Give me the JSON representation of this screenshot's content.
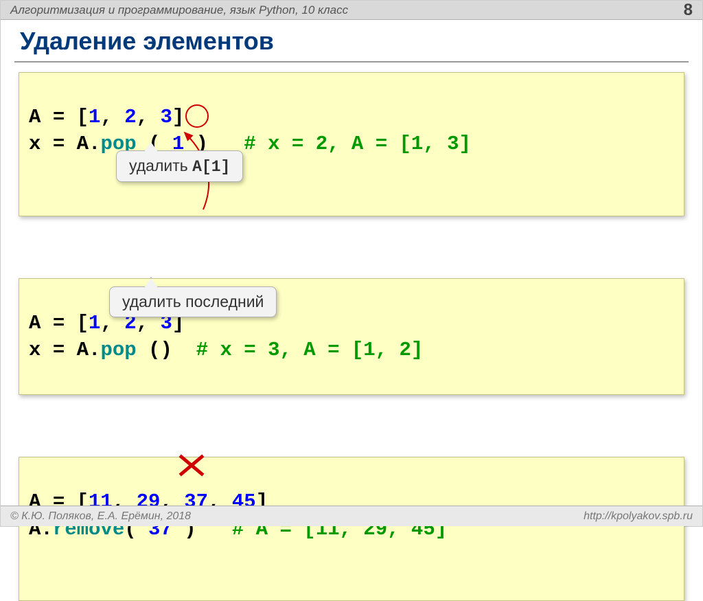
{
  "header": {
    "course": "Алгоритмизация и программирование, язык Python, 10 класс",
    "page_number": "8"
  },
  "title": "Удаление элементов",
  "code1": {
    "line1": {
      "a": "A ",
      "eq": "= [",
      "n1": "1",
      "c1": ", ",
      "n2": "2",
      "c2": ", ",
      "n3": "3",
      "end": "]"
    },
    "line2": {
      "x": "x ",
      "eq": "= A.",
      "pop": "pop",
      "paren": " ( ",
      "arg": "1",
      "close": " )   ",
      "comment": "# x = 2, A = [1, 3]"
    }
  },
  "callout1": {
    "pre": "удалить ",
    "mono": "A[1]"
  },
  "code2": {
    "line1": {
      "a": "A ",
      "eq": "= [",
      "n1": "1",
      "c1": ", ",
      "n2": "2",
      "c2": ", ",
      "n3": "3",
      "end": "]"
    },
    "line2": {
      "x": "x ",
      "eq": "= A.",
      "pop": "pop",
      "paren": " ()  ",
      "comment": "# x = 3, A = [1, 2]"
    }
  },
  "callout2": "удалить последний",
  "code3": {
    "line1": {
      "a": "A ",
      "eq": "= [",
      "n1": "11",
      "c1": ", ",
      "n2": "29",
      "c2": ", ",
      "n3": "37",
      "c3": ", ",
      "n4": "45",
      "end": "]"
    },
    "line2": {
      "a": "A.",
      "remove": "remove",
      "paren": "( ",
      "arg": "37",
      "close": " )   ",
      "comment": "# A = [11, 29, 45]"
    }
  },
  "footer": {
    "left": "© К.Ю. Поляков, Е.А. Ерёмин, 2018",
    "right": "http://kpolyakov.spb.ru"
  }
}
